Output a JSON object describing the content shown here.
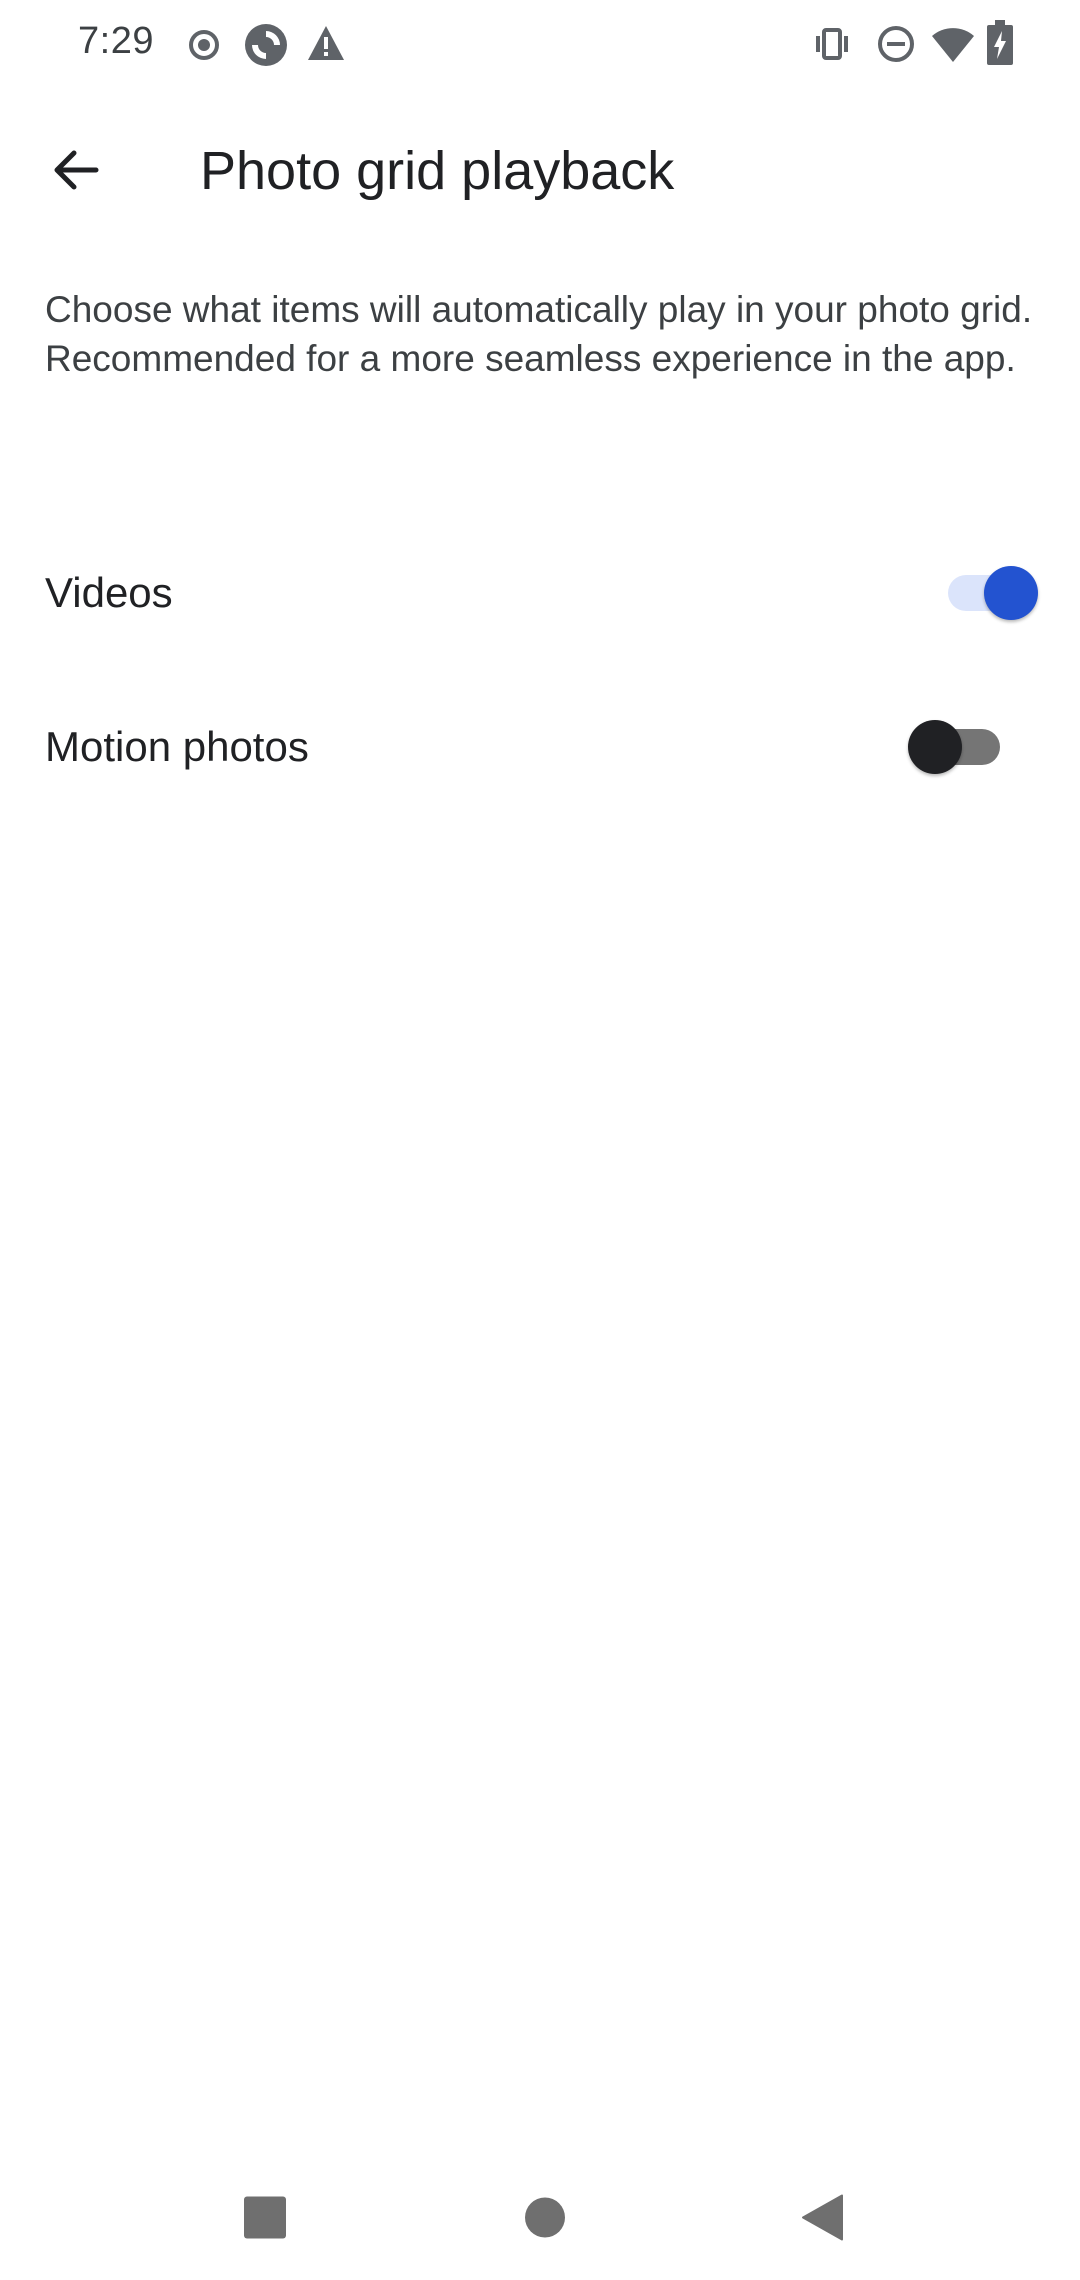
{
  "status_bar": {
    "time": "7:29",
    "left_icons": [
      "record-icon",
      "sync-icon",
      "warning-icon"
    ],
    "right_icons": [
      "vibrate-icon",
      "do-not-disturb-icon",
      "wifi-icon",
      "battery-charging-icon"
    ]
  },
  "app_bar": {
    "back_icon": "arrow-back-icon",
    "title": "Photo grid playback"
  },
  "description": "Choose what items will automatically play in your photo grid. Recommended for a more seamless experience in the app.",
  "settings": [
    {
      "label": "Videos",
      "enabled": true
    },
    {
      "label": "Motion photos",
      "enabled": false
    }
  ],
  "colors": {
    "accent": "#2353d0",
    "accent_track": "#dbe4fb",
    "switch_off_thumb": "#202124",
    "switch_off_track": "#757575",
    "text_primary": "#202124",
    "text_secondary": "#3c4043",
    "nav_icon": "#6f6f6f"
  },
  "nav_bar": {
    "buttons": [
      "recents-square-icon",
      "home-circle-icon",
      "back-triangle-icon"
    ]
  }
}
